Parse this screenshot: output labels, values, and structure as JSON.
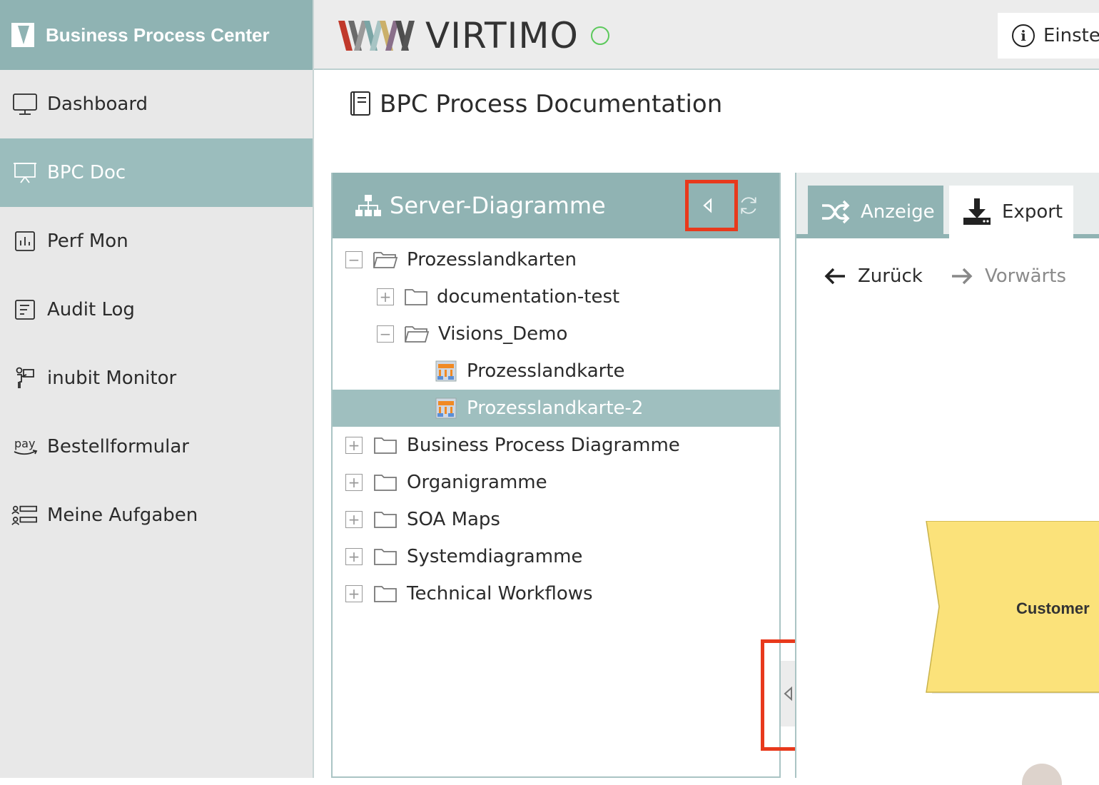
{
  "sidebar": {
    "brand": "Business Process Center",
    "items": [
      {
        "label": "Dashboard",
        "icon": "monitor-icon"
      },
      {
        "label": "BPC Doc",
        "icon": "presentation-icon",
        "active": true
      },
      {
        "label": "Perf Mon",
        "icon": "bar-chart-icon"
      },
      {
        "label": "Audit Log",
        "icon": "document-list-icon"
      },
      {
        "label": "inubit Monitor",
        "icon": "presenter-icon"
      },
      {
        "label": "Bestellformular",
        "icon": "amazon-pay-icon"
      },
      {
        "label": "Meine Aufgaben",
        "icon": "tasks-icon"
      }
    ]
  },
  "header": {
    "logo_text": "VIRTIMO",
    "info_label": "Einste"
  },
  "page": {
    "title": "BPC Process Documentation"
  },
  "tree": {
    "title": "Server-Diagramme",
    "nodes": [
      {
        "label": "Prozesslandkarten",
        "type": "folder",
        "expanded": true
      },
      {
        "label": "documentation-test",
        "type": "folder",
        "expanded": false
      },
      {
        "label": "Visions_Demo",
        "type": "folder",
        "expanded": true
      },
      {
        "label": "Prozesslandkarte",
        "type": "diagram"
      },
      {
        "label": "Prozesslandkarte-2",
        "type": "diagram",
        "selected": true
      },
      {
        "label": "Business Process Diagramme",
        "type": "folder",
        "expanded": false
      },
      {
        "label": "Organigramme",
        "type": "folder",
        "expanded": false
      },
      {
        "label": "SOA Maps",
        "type": "folder",
        "expanded": false
      },
      {
        "label": "Systemdiagramme",
        "type": "folder",
        "expanded": false
      },
      {
        "label": "Technical Workflows",
        "type": "folder",
        "expanded": false
      }
    ]
  },
  "view": {
    "tabs": [
      {
        "label": "Anzeige",
        "active": true
      },
      {
        "label": "Export",
        "active": false
      }
    ],
    "back_label": "Zurück",
    "forward_label": "Vorwärts",
    "shape_label": "Customer"
  },
  "colors": {
    "accent": "#90b3b3",
    "highlight": "#e8391c",
    "shape_fill": "#fbe27a"
  }
}
